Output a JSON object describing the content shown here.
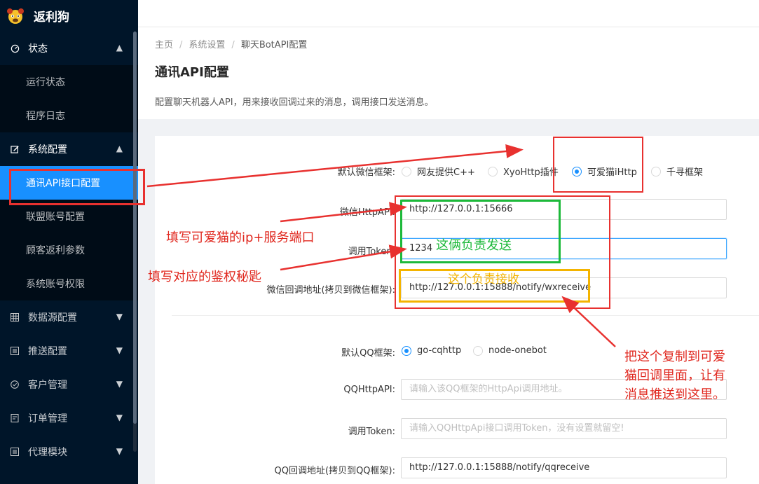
{
  "app": {
    "title": "返利狗"
  },
  "sidebar": {
    "groups": [
      {
        "label": "状态",
        "icon": "dashboard-icon",
        "arrow": "▲",
        "items": [
          {
            "label": "运行状态"
          },
          {
            "label": "程序日志"
          }
        ]
      },
      {
        "label": "系统配置",
        "icon": "edit-icon",
        "arrow": "▲",
        "items": [
          {
            "label": "通讯API接口配置"
          },
          {
            "label": "联盟账号配置"
          },
          {
            "label": "顾客返利参数"
          },
          {
            "label": "系统账号权限"
          }
        ]
      },
      {
        "label": "数据源配置",
        "icon": "grid-icon",
        "arrow": "▼"
      },
      {
        "label": "推送配置",
        "icon": "list-icon",
        "arrow": "▼"
      },
      {
        "label": "客户管理",
        "icon": "check-circle-icon",
        "arrow": "▼"
      },
      {
        "label": "订单管理",
        "icon": "order-icon",
        "arrow": "▼"
      },
      {
        "label": "代理模块",
        "icon": "list-icon",
        "arrow": "▼"
      }
    ]
  },
  "breadcrumb": {
    "items": [
      "主页",
      "系统设置",
      "聊天BotAPI配置"
    ],
    "separator": "/"
  },
  "page": {
    "title": "通讯API配置",
    "description": "配置聊天机器人API，用来接收回调过来的消息，调用接口发送消息。"
  },
  "form": {
    "wechat_framework": {
      "label": "默认微信框架:",
      "options": [
        "网友提供C++",
        "XyoHttp插件",
        "可爱猫iHttp",
        "千寻框架"
      ],
      "selected": "可爱猫iHttp"
    },
    "wechat_http_api": {
      "label": "微信HttpAPI:",
      "value": "http://127.0.0.1:15666"
    },
    "token": {
      "label": "调用Token:",
      "value": "1234"
    },
    "wechat_callback": {
      "label": "微信回调地址(拷贝到微信框架):",
      "value": "http://127.0.0.1:15888/notify/wxreceive"
    },
    "qq_framework": {
      "label": "默认QQ框架:",
      "options": [
        "go-cqhttp",
        "node-onebot"
      ],
      "selected": "go-cqhttp"
    },
    "qq_http_api": {
      "label": "QQHttpAPI:",
      "value": "",
      "placeholder": "请输入该QQ框架的HttpApi调用地址。"
    },
    "qq_token": {
      "label": "调用Token:",
      "value": "",
      "placeholder": "请输入QQHttpApi接口调用Token，没有设置就留空!"
    },
    "qq_callback": {
      "label": "QQ回调地址(拷贝到QQ框架):",
      "value": "http://127.0.0.1:15888/notify/qqreceive"
    }
  },
  "annotations": {
    "fill_ip_port": "填写可爱猫的ip+服务端口",
    "fill_token": "填写对应的鉴权秘匙",
    "send_note": "这俩负责发送",
    "receive_note": "这个负责接收",
    "copy_note": [
      "把这个复制到可爱",
      "猫回调里面，让有",
      "消息推送到这里。"
    ],
    "colors": {
      "red": "#e8312f",
      "green": "#1db93a",
      "yellow": "#f4b400",
      "annotation_text_red": "#e0271e"
    }
  }
}
